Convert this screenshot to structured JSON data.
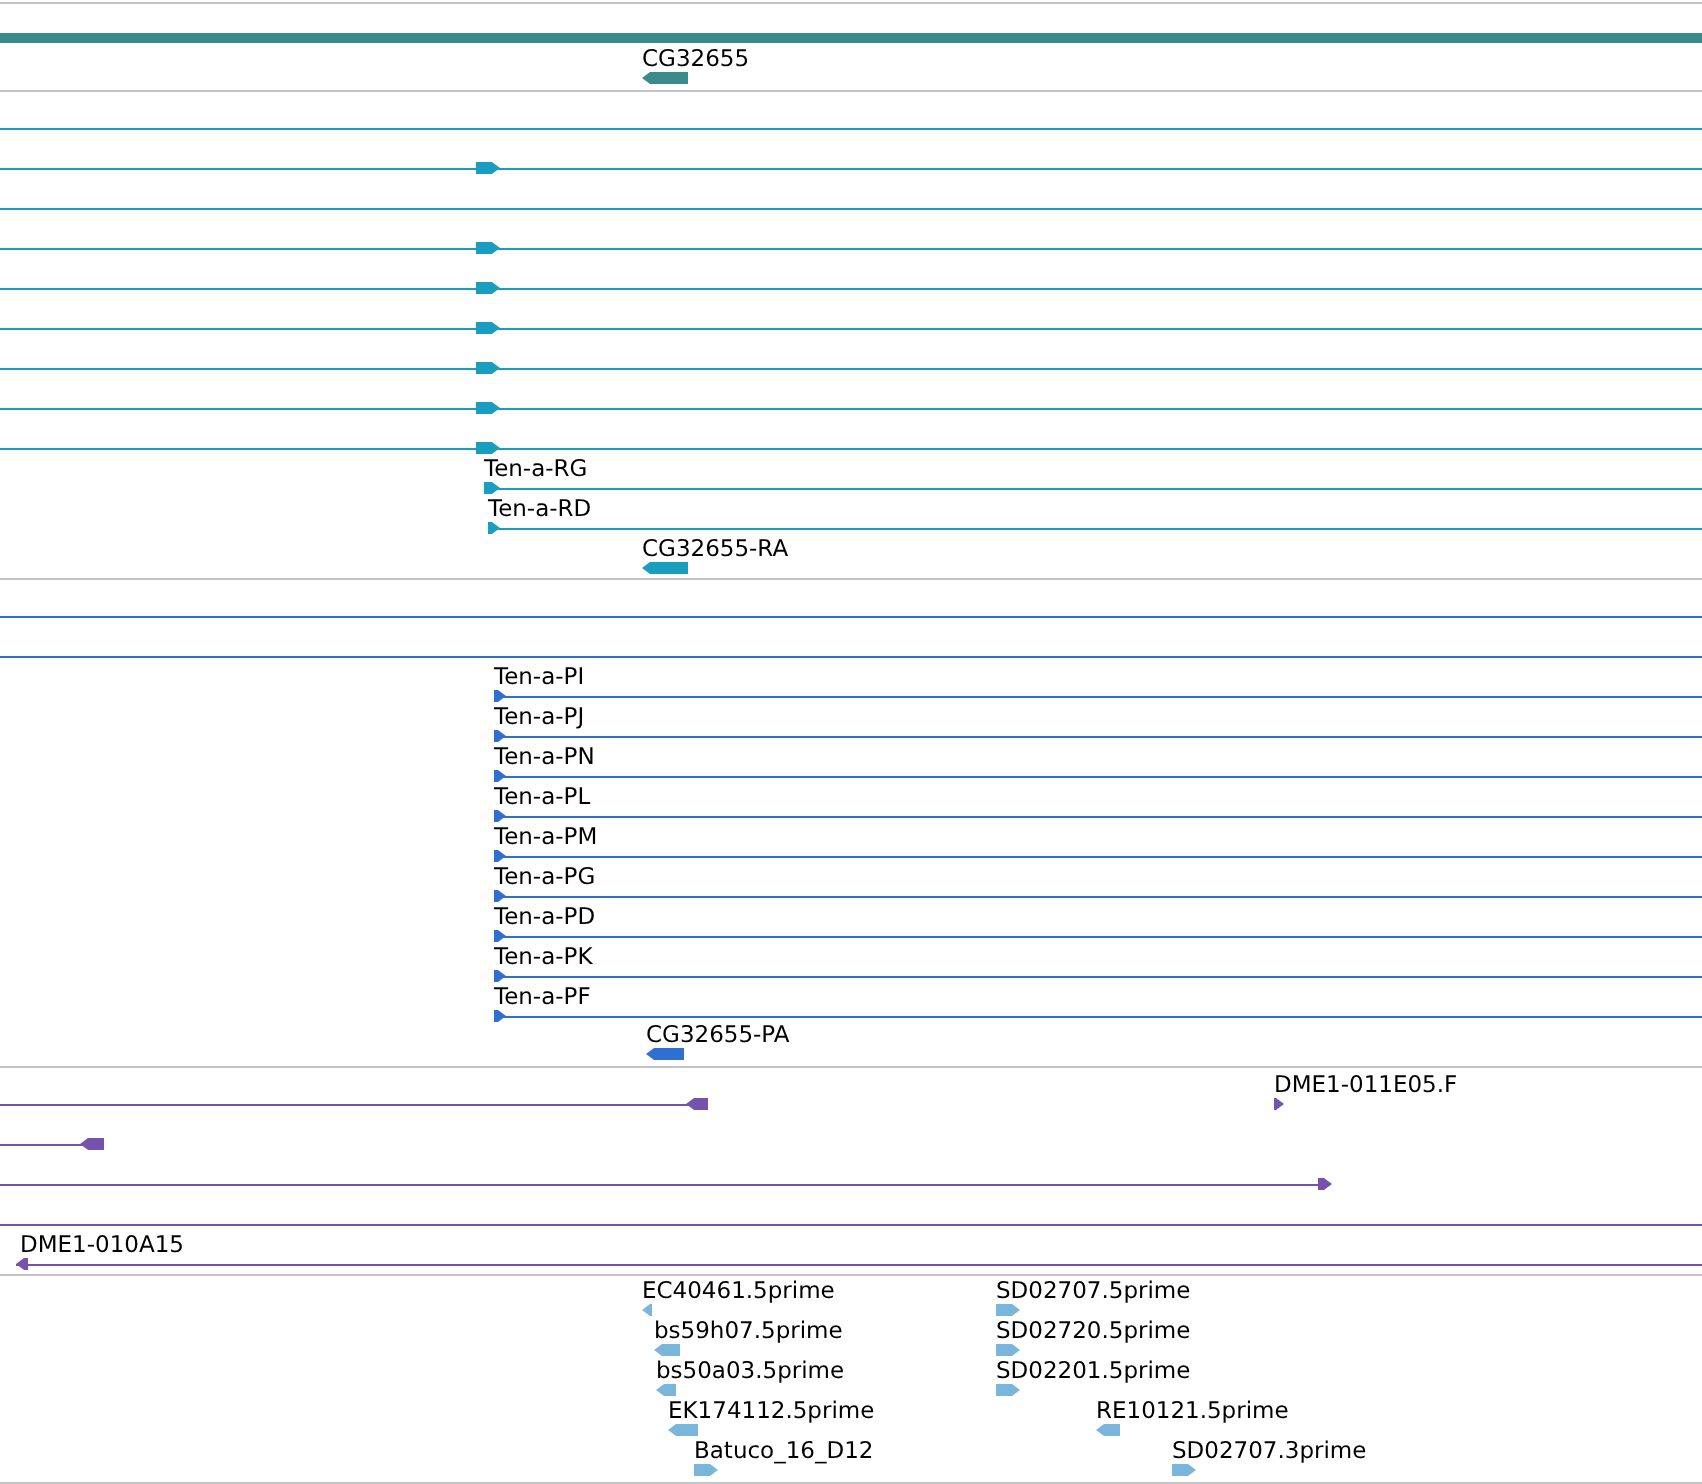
{
  "tracks": [
    {
      "color": "#3a8c8c",
      "features": [
        {
          "kind": "bar"
        },
        {
          "kind": "transcript",
          "label": "CG32655",
          "reverse": true
        }
      ]
    },
    {
      "color": "#1a9ec0",
      "features": [
        {
          "kind": "transcript"
        },
        {
          "kind": "transcript",
          "reverse": false
        },
        {
          "kind": "transcript"
        },
        {
          "kind": "transcript",
          "reverse": false
        },
        {
          "kind": "transcript",
          "reverse": false
        },
        {
          "kind": "transcript",
          "reverse": false
        },
        {
          "kind": "transcript",
          "reverse": false
        },
        {
          "kind": "transcript",
          "reverse": false
        },
        {
          "kind": "transcript",
          "reverse": false
        },
        {
          "kind": "transcript",
          "label": "Ten-a-RG",
          "reverse": false
        },
        {
          "kind": "transcript",
          "label": "Ten-a-RD",
          "reverse": false
        },
        {
          "kind": "transcript",
          "label": "CG32655-RA",
          "reverse": true
        }
      ]
    },
    {
      "color": "#2f6fd0",
      "features": [
        {
          "kind": "transcript"
        },
        {
          "kind": "transcript"
        },
        {
          "kind": "transcript",
          "label": "Ten-a-PI",
          "reverse": false
        },
        {
          "kind": "transcript",
          "label": "Ten-a-PJ",
          "reverse": false
        },
        {
          "kind": "transcript",
          "label": "Ten-a-PN",
          "reverse": false
        },
        {
          "kind": "transcript",
          "label": "Ten-a-PL",
          "reverse": false
        },
        {
          "kind": "transcript",
          "label": "Ten-a-PM",
          "reverse": false
        },
        {
          "kind": "transcript",
          "label": "Ten-a-PG",
          "reverse": false
        },
        {
          "kind": "transcript",
          "label": "Ten-a-PD",
          "reverse": false
        },
        {
          "kind": "transcript",
          "label": "Ten-a-PK",
          "reverse": false
        },
        {
          "kind": "transcript",
          "label": "Ten-a-PF",
          "reverse": false
        },
        {
          "kind": "transcript",
          "label": "CG32655-PA",
          "reverse": true
        }
      ]
    },
    {
      "color": "#7553ad",
      "features": [
        {
          "kind": "transcript",
          "reverse": true
        },
        {
          "kind": "transcript",
          "reverse": true
        },
        {
          "kind": "transcript",
          "label": "DME1-011E05.F",
          "reverse": false
        },
        {
          "kind": "transcript",
          "reverse": false
        },
        {
          "kind": "transcript"
        },
        {
          "kind": "transcript",
          "label": "DME1-010A15",
          "reverse": true
        }
      ]
    },
    {
      "color": "#7ab6dc",
      "features": [
        {
          "kind": "transcript",
          "label": "EC40461.5prime",
          "reverse": true
        },
        {
          "kind": "transcript",
          "label": "bs59h07.5prime",
          "reverse": true
        },
        {
          "kind": "transcript",
          "label": "bs50a03.5prime",
          "reverse": true
        },
        {
          "kind": "transcript",
          "label": "EK174112.5prime",
          "reverse": true
        },
        {
          "kind": "transcript",
          "label": "Batuco_16_D12",
          "reverse": false
        },
        {
          "kind": "transcript",
          "label": "SD02707.5prime",
          "reverse": false
        },
        {
          "kind": "transcript",
          "label": "SD02720.5prime",
          "reverse": false
        },
        {
          "kind": "transcript",
          "label": "SD02201.5prime",
          "reverse": false
        },
        {
          "kind": "transcript",
          "label": "RE10121.5prime",
          "reverse": true
        },
        {
          "kind": "transcript",
          "label": "SD02707.3prime",
          "reverse": false
        }
      ]
    }
  ]
}
